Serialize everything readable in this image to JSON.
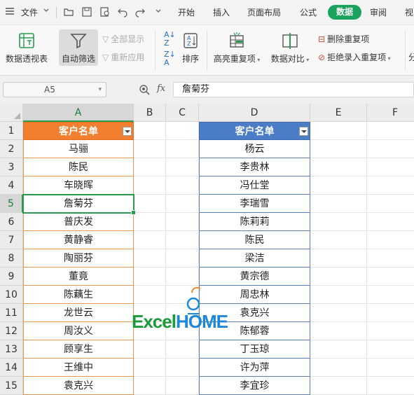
{
  "menubar": {
    "file_label": "文件",
    "tabs": [
      "开始",
      "插入",
      "页面布局",
      "公式",
      "数据",
      "审阅",
      "视"
    ],
    "active_tab": "数据"
  },
  "ribbon": {
    "pivot_label": "数据透视表",
    "autofilter_label": "自动筛选",
    "show_all_label": "全部显示",
    "reapply_label": "重新应用",
    "sort_label": "排序",
    "highlight_dup_label": "高亮重复项",
    "compare_label": "数据对比",
    "remove_dup_label": "删除重复项",
    "reject_dup_label": "拒绝录入重复项",
    "split_label": "分"
  },
  "formula_bar": {
    "name_box": "A5",
    "fx_label": "fx",
    "content": "詹菊芬"
  },
  "columns": [
    "A",
    "B",
    "C",
    "D",
    "E",
    "F"
  ],
  "selected_column": "A",
  "rows": [
    "1",
    "2",
    "3",
    "4",
    "5",
    "6",
    "7",
    "8",
    "9",
    "10",
    "11",
    "12",
    "13",
    "14",
    "15"
  ],
  "selected_row": "5",
  "table_a": {
    "header": "客户名单",
    "values": [
      "马骊",
      "陈民",
      "车晓晖",
      "詹菊芬",
      "普庆发",
      "黄静睿",
      "陶丽芬",
      "董竟",
      "陈藕生",
      "龙世云",
      "周汝义",
      "顾享生",
      "王维中",
      "袁克兴"
    ]
  },
  "table_d": {
    "header": "客户名单",
    "values": [
      "杨云",
      "李贵林",
      "冯仕堂",
      "李瑞雪",
      "陈莉莉",
      "陈民",
      "梁洁",
      "黄宗德",
      "周忠林",
      "袁克兴",
      "陈郁蓉",
      "丁玉琼",
      "许为萍",
      "李宜珍"
    ]
  },
  "watermark": {
    "part1": "Excel",
    "part2": "HOME"
  },
  "colors": {
    "table_a_header": "#f27e2f",
    "table_d_header": "#4a7dc5",
    "accent": "#1aa35c"
  }
}
